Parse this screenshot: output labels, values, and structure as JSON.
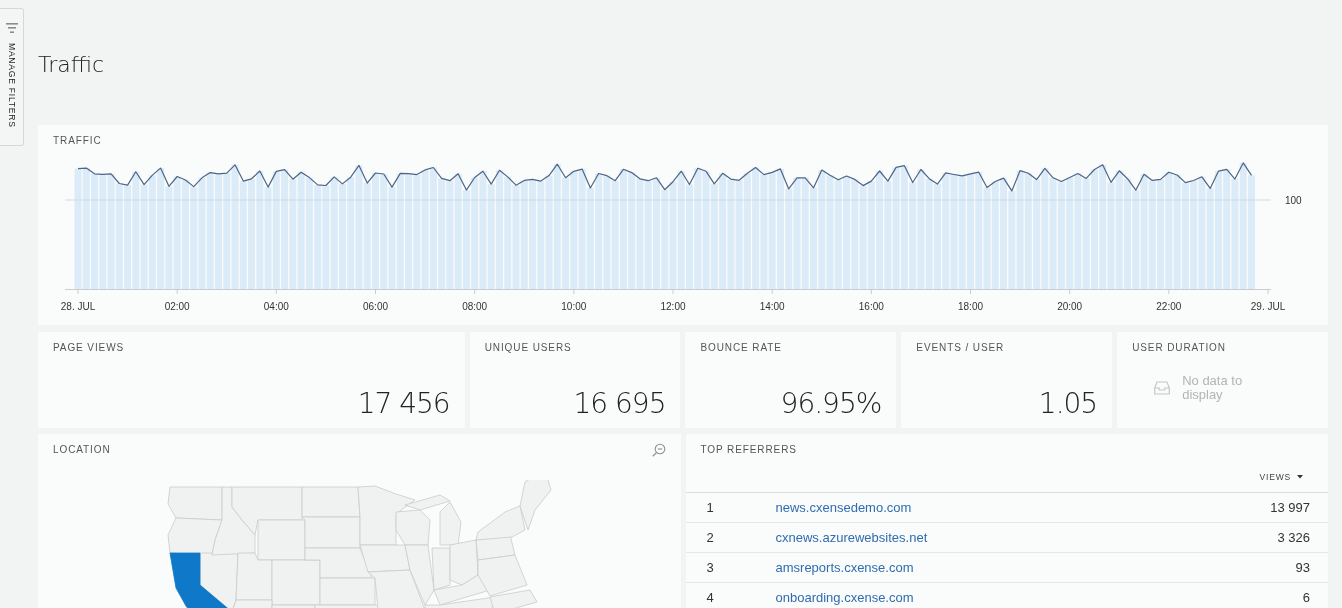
{
  "sidebar_tab": {
    "label": "MANAGE FILTERS"
  },
  "page_title": "Traffic",
  "traffic": {
    "title": "TRAFFIC",
    "y_labels": [
      "100"
    ],
    "x_labels": [
      "28. JUL",
      "02:00",
      "04:00",
      "06:00",
      "08:00",
      "10:00",
      "12:00",
      "14:00",
      "16:00",
      "18:00",
      "20:00",
      "22:00",
      "29. JUL"
    ]
  },
  "metrics": [
    {
      "kind": "value",
      "title": "PAGE VIEWS",
      "value": "17 456"
    },
    {
      "kind": "value",
      "title": "UNIQUE USERS",
      "value": "16 695"
    },
    {
      "kind": "value",
      "title": "BOUNCE RATE",
      "value": "96.95%"
    },
    {
      "kind": "value",
      "title": "EVENTS / USER",
      "value": "1.05"
    },
    {
      "kind": "empty",
      "title": "USER DURATION",
      "message": "No data to display"
    }
  ],
  "location": {
    "title": "LOCATION"
  },
  "top_referrers": {
    "title": "TOP REFERRERS",
    "views_column": {
      "label": "VIEWS",
      "sorted": true
    },
    "rows": [
      {
        "column_1": "1",
        "column_2": "news.cxensedemo.com",
        "views": "13 997"
      },
      {
        "column_1": "2",
        "column_2": "cxnews.azurewebsites.net",
        "views": "3 326"
      },
      {
        "column_1": "3",
        "column_2": "amsreports.cxense.com",
        "views": "93"
      },
      {
        "column_1": "4",
        "column_2": "onboarding.cxense.com",
        "views": "6"
      }
    ]
  }
}
